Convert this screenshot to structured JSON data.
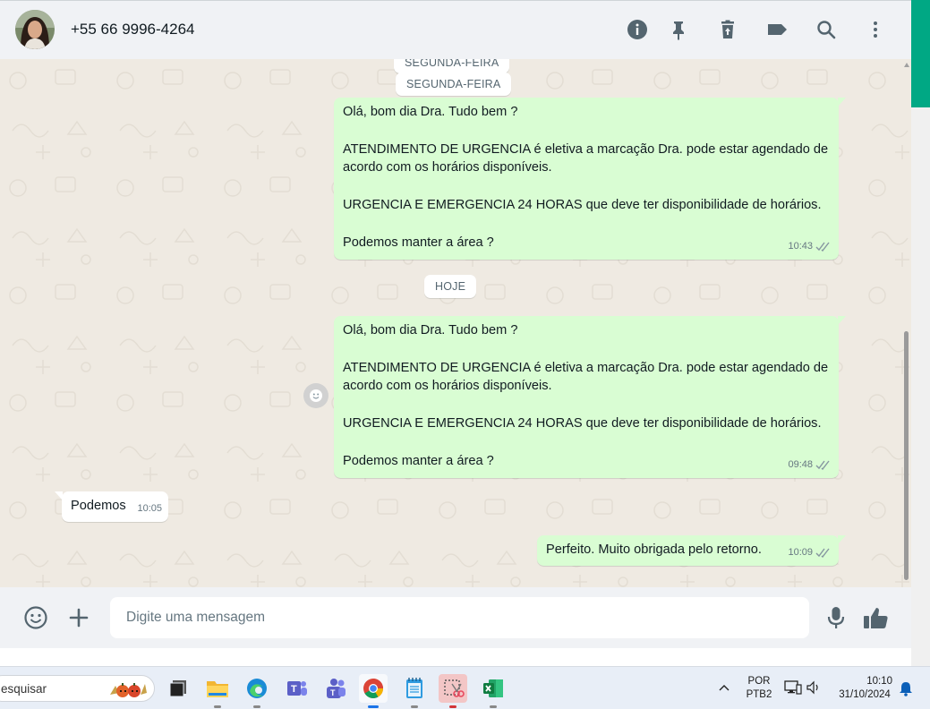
{
  "header": {
    "contact_name": "+55 66 9996-4264",
    "icons": [
      "info-icon",
      "pin-icon",
      "delete-icon",
      "label-icon",
      "search-icon",
      "menu-icon"
    ]
  },
  "chat": {
    "date_chips": {
      "partial": "SEGUNDA-FEIRA",
      "first": "SEGUNDA-FEIRA",
      "today": "HOJE"
    },
    "messages": [
      {
        "direction": "out",
        "text": "Olá, bom dia Dra. Tudo bem ?\n\nATENDIMENTO DE URGENCIA é eletiva a marcação Dra. pode estar agendado de acordo com os horários disponíveis.\n\nURGENCIA E EMERGENCIA 24 HORAS que deve ter disponibilidade de horários.\n\nPodemos manter a área ?",
        "time": "10:43",
        "status": "read"
      },
      {
        "direction": "out",
        "text": "Olá, bom dia Dra. Tudo bem ?\n\nATENDIMENTO DE URGENCIA é eletiva a marcação Dra. pode estar agendado de acordo com os horários disponíveis.\n\nURGENCIA E EMERGENCIA 24 HORAS que deve ter disponibilidade de horários.\n\nPodemos manter a área ?",
        "time": "09:48",
        "status": "read"
      },
      {
        "direction": "in",
        "text": "Podemos",
        "time": "10:05"
      },
      {
        "direction": "out",
        "text": "Perfeito. Muito obrigada pelo retorno.",
        "time": "10:09",
        "status": "read"
      }
    ]
  },
  "compose": {
    "placeholder": "Digite uma mensagem",
    "value": ""
  },
  "taskbar": {
    "search_text": "esquisar",
    "language": "POR",
    "keyboard": "PTB2",
    "time": "10:10",
    "date": "31/10/2024",
    "apps": [
      "task-view",
      "file-explorer",
      "edge",
      "teams-personal",
      "teams-work",
      "chrome",
      "notepad",
      "snipping-tool",
      "excel"
    ]
  },
  "colors": {
    "accent": "#00a884",
    "outgoing_bubble": "#d9fdd3",
    "chat_background": "#efeae2",
    "header_background": "#f0f2f5"
  }
}
